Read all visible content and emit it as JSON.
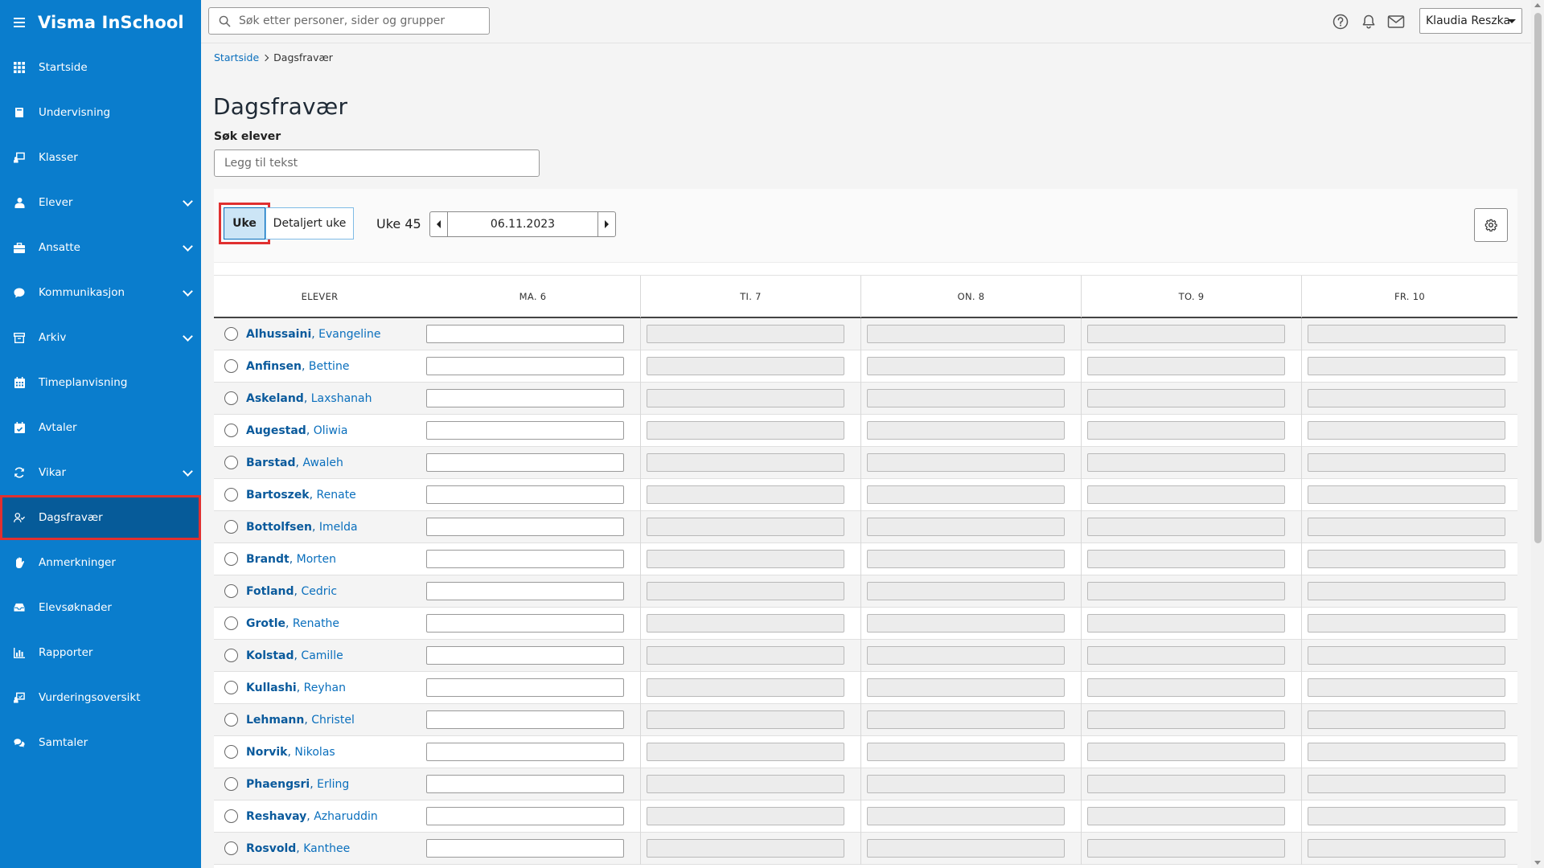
{
  "app": {
    "brand": "Visma InSchool"
  },
  "sidebar": {
    "items": [
      {
        "label": "Startside",
        "icon": "grid-icon",
        "expandable": false
      },
      {
        "label": "Undervisning",
        "icon": "book-icon",
        "expandable": false
      },
      {
        "label": "Klasser",
        "icon": "classroom-icon",
        "expandable": false
      },
      {
        "label": "Elever",
        "icon": "student-icon",
        "expandable": true
      },
      {
        "label": "Ansatte",
        "icon": "briefcase-icon",
        "expandable": true
      },
      {
        "label": "Kommunikasjon",
        "icon": "chat-bubble-icon",
        "expandable": true
      },
      {
        "label": "Arkiv",
        "icon": "archive-icon",
        "expandable": true
      },
      {
        "label": "Timeplanvisning",
        "icon": "calendar-icon",
        "expandable": false
      },
      {
        "label": "Avtaler",
        "icon": "calendar-check-icon",
        "expandable": false
      },
      {
        "label": "Vikar",
        "icon": "sync-icon",
        "expandable": true
      },
      {
        "label": "Dagsfravær",
        "icon": "user-check-icon",
        "expandable": false,
        "active": true
      },
      {
        "label": "Anmerkninger",
        "icon": "hand-icon",
        "expandable": false
      },
      {
        "label": "Elevsøknader",
        "icon": "inbox-icon",
        "expandable": false
      },
      {
        "label": "Rapporter",
        "icon": "bar-chart-icon",
        "expandable": false
      },
      {
        "label": "Vurderingsoversikt",
        "icon": "assessment-icon",
        "expandable": false
      },
      {
        "label": "Samtaler",
        "icon": "conversation-icon",
        "expandable": false
      }
    ]
  },
  "topbar": {
    "search_placeholder": "Søk etter personer, sider og grupper",
    "user_name": "Klaudia Reszka"
  },
  "breadcrumb": {
    "home": "Startside",
    "current": "Dagsfravær"
  },
  "page": {
    "title": "Dagsfravær",
    "search_label": "Søk elever",
    "search_placeholder": "Legg til tekst"
  },
  "toolbar": {
    "view_week": "Uke",
    "view_detailed_week": "Detaljert uke",
    "week_label": "Uke 45",
    "date": "06.11.2023",
    "selected_view": "Uke"
  },
  "table": {
    "columns": [
      "ELEVER",
      "MA. 6",
      "TI. 7",
      "ON. 8",
      "TO. 9",
      "FR. 10"
    ],
    "editable_day_index": 0,
    "students": [
      {
        "last": "Alhussaini",
        "first": "Evangeline"
      },
      {
        "last": "Anfinsen",
        "first": "Bettine"
      },
      {
        "last": "Askeland",
        "first": "Laxshanah"
      },
      {
        "last": "Augestad",
        "first": "Oliwia"
      },
      {
        "last": "Barstad",
        "first": "Awaleh"
      },
      {
        "last": "Bartoszek",
        "first": "Renate"
      },
      {
        "last": "Bottolfsen",
        "first": "Imelda"
      },
      {
        "last": "Brandt",
        "first": "Morten"
      },
      {
        "last": "Fotland",
        "first": "Cedric"
      },
      {
        "last": "Grotle",
        "first": "Renathe"
      },
      {
        "last": "Kolstad",
        "first": "Camille"
      },
      {
        "last": "Kullashi",
        "first": "Reyhan"
      },
      {
        "last": "Lehmann",
        "first": "Christel"
      },
      {
        "last": "Norvik",
        "first": "Nikolas"
      },
      {
        "last": "Phaengsri",
        "first": "Erling"
      },
      {
        "last": "Reshavay",
        "first": "Azharuddin"
      },
      {
        "last": "Rosvold",
        "first": "Kanthee"
      }
    ]
  },
  "colors": {
    "sidebar_bg": "#0a7dcd",
    "sidebar_active_bg": "#065b99",
    "highlight_outline": "#e03030",
    "link": "#0a6fbd",
    "selected_button_bg": "#cce5f6"
  }
}
